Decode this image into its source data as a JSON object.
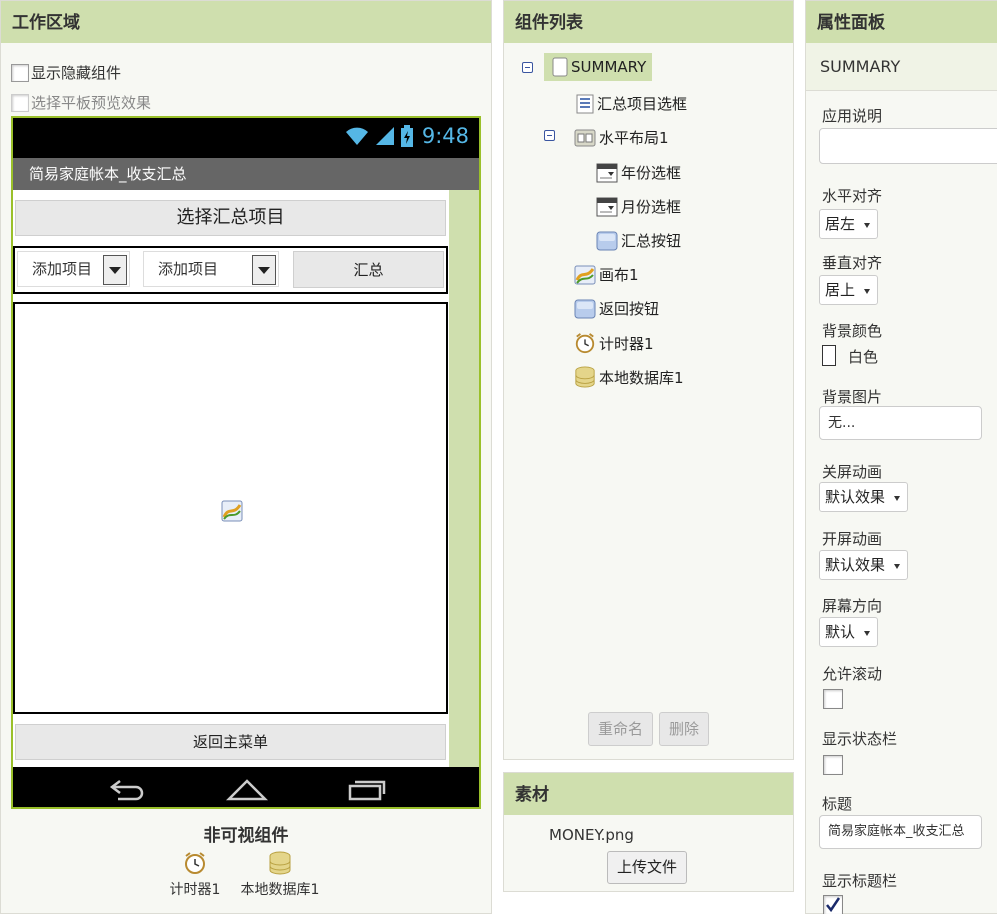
{
  "workspace": {
    "title": "工作区域",
    "show_hidden_label": "显示隐藏组件",
    "tablet_preview_label": "选择平板预览效果",
    "phone": {
      "time": "9:48",
      "screen_title": "简易家庭帐本_收支汇总",
      "select_button": "选择汇总项目",
      "spinner1": "添加项目",
      "spinner2": "添加项目",
      "sum_button": "汇总",
      "back_button": "返回主菜单"
    },
    "nonvisible_title": "非可视组件",
    "nonvisible": [
      "计时器1",
      "本地数据库1"
    ]
  },
  "components": {
    "title": "组件列表",
    "items": [
      "SUMMARY",
      "汇总项目选框",
      "水平布局1",
      "年份选框",
      "月份选框",
      "汇总按钮",
      "画布1",
      "返回按钮",
      "计时器1",
      "本地数据库1"
    ],
    "rename_button": "重命名",
    "delete_button": "删除"
  },
  "assets": {
    "title": "素材",
    "file": "MONEY.png",
    "upload_button": "上传文件"
  },
  "properties": {
    "title": "属性面板",
    "component": "SUMMARY",
    "app_description_label": "应用说明",
    "app_description_value": "",
    "h_align_label": "水平对齐",
    "h_align_value": "居左",
    "v_align_label": "垂直对齐",
    "v_align_value": "居上",
    "bg_color_label": "背景颜色",
    "bg_color_value": "白色",
    "bg_color_hex": "#ffffff",
    "bg_image_label": "背景图片",
    "bg_image_value": "无...",
    "close_anim_label": "关屏动画",
    "close_anim_value": "默认效果",
    "open_anim_label": "开屏动画",
    "open_anim_value": "默认效果",
    "orientation_label": "屏幕方向",
    "orientation_value": "默认",
    "scrollable_label": "允许滚动",
    "scrollable_checked": false,
    "show_status_label": "显示状态栏",
    "show_status_checked": false,
    "title_label": "标题",
    "title_value": "简易家庭帐本_收支汇总",
    "show_titlebar_label": "显示标题栏",
    "show_titlebar_checked": true
  },
  "colors": {
    "header_bg": "#cfdfae",
    "phone_border": "#9ac02a",
    "clock": "#55b7e6"
  }
}
